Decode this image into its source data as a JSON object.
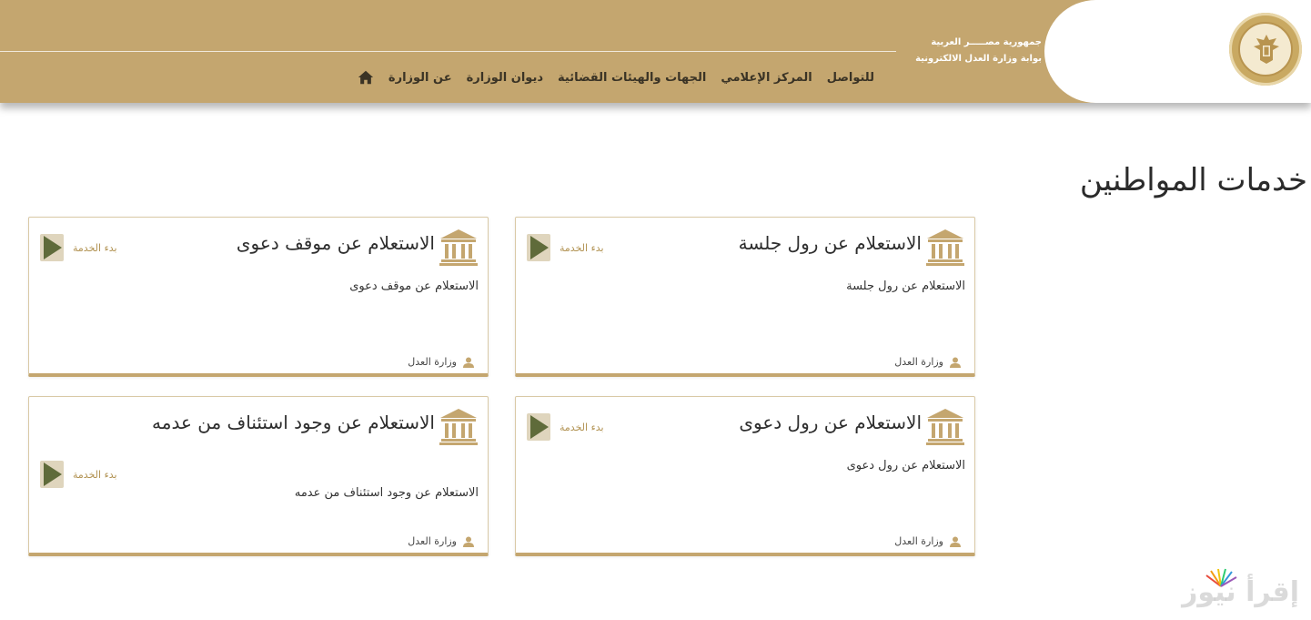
{
  "header": {
    "ministry_line1": "جمهورية مصـــــر العربية",
    "ministry_line2": "بوابة وزارة العدل الالكترونية",
    "nav": [
      {
        "label": "عن الوزارة"
      },
      {
        "label": "ديوان الوزارة"
      },
      {
        "label": "الجهات والهيئات القضائية"
      },
      {
        "label": "المركز الإعلامي"
      },
      {
        "label": "للتواصل"
      }
    ]
  },
  "page": {
    "title": "خدمات المواطنين"
  },
  "cards": [
    {
      "title": "الاستعلام عن رول جلسة",
      "description": "الاستعلام عن رول جلسة",
      "start_label": "بدء الخدمة",
      "provider": "وزارة العدل"
    },
    {
      "title": "الاستعلام عن موقف دعوى",
      "description": "الاستعلام عن موقف دعوى",
      "start_label": "بدء الخدمة",
      "provider": "وزارة العدل"
    },
    {
      "title": "الاستعلام عن رول دعوى",
      "description": "الاستعلام عن رول دعوى",
      "start_label": "بدء الخدمة",
      "provider": "وزارة العدل"
    },
    {
      "title": "الاستعلام عن وجود استئناف من عدمه",
      "description": "الاستعلام عن وجود استئناف من عدمه",
      "start_label": "بدء الخدمة",
      "provider": "وزارة العدل"
    }
  ],
  "watermark": {
    "text": "إقرأ نيوز"
  },
  "colors": {
    "header": "#c4a66f",
    "accent_gold": "#c4a66f",
    "play_green": "#5f6b3a",
    "start_text": "#b29353"
  },
  "icons": {
    "home": "home-icon",
    "card": "courthouse-icon",
    "start": "play-icon",
    "provider": "user-icon"
  }
}
